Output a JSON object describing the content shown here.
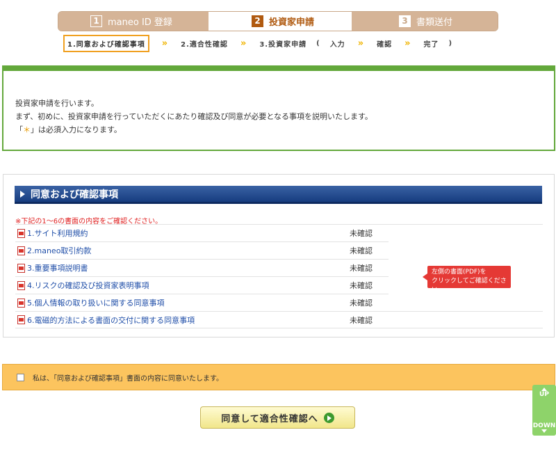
{
  "steps": [
    {
      "num": "1",
      "label": "maneo ID 登録"
    },
    {
      "num": "2",
      "label": "投資家申請"
    },
    {
      "num": "3",
      "label": "書類送付"
    }
  ],
  "substeps": {
    "s1": "1.同意および確認事項",
    "s2": "2.適合性確認",
    "s3": "3.投資家申請",
    "open": "(",
    "s4": "入力",
    "s5": "確認",
    "s6": "完了",
    "close": ")"
  },
  "intro": {
    "line1": "投資家申請を行います。",
    "line2": "まず、初めに、投資家申請を行っていただくにあたり確認及び同意が必要となる事項を説明いたします。",
    "line3_pre": "「",
    "line3_mark": "＊",
    "line3_post": "」は必須入力になります。"
  },
  "agreement": {
    "heading": "同意および確認事項",
    "notice": "※下記の1～6の書面の内容をご確認ください。",
    "documents": [
      {
        "title": "1.サイト利用規約",
        "status": "未確認"
      },
      {
        "title": "2.maneo取引約款",
        "status": "未確認"
      },
      {
        "title": "3.重要事項説明書",
        "status": "未確認"
      },
      {
        "title": "4.リスクの確認及び投資家表明事項",
        "status": "未確認"
      },
      {
        "title": "5.個人情報の取り扱いに関する同意事項",
        "status": "未確認"
      },
      {
        "title": "6.電磁的方法による書面の交付に関する同意事項",
        "status": "未確認"
      }
    ],
    "callout_line1": "左側の書面(PDF)を",
    "callout_line2": "クリックしてご確認ください"
  },
  "consent": {
    "label": "私は、「同意および確認事項」書面の内容に同意いたします。",
    "checked": false
  },
  "proceed_label": "同意して適合性確認へ",
  "scroll": {
    "up": "UP",
    "down": "DOWN"
  },
  "colors": {
    "accent_green": "#63a83b",
    "header_blue": "#173d80",
    "notice_red": "#e02020",
    "consent_bg": "#fcc45e"
  }
}
